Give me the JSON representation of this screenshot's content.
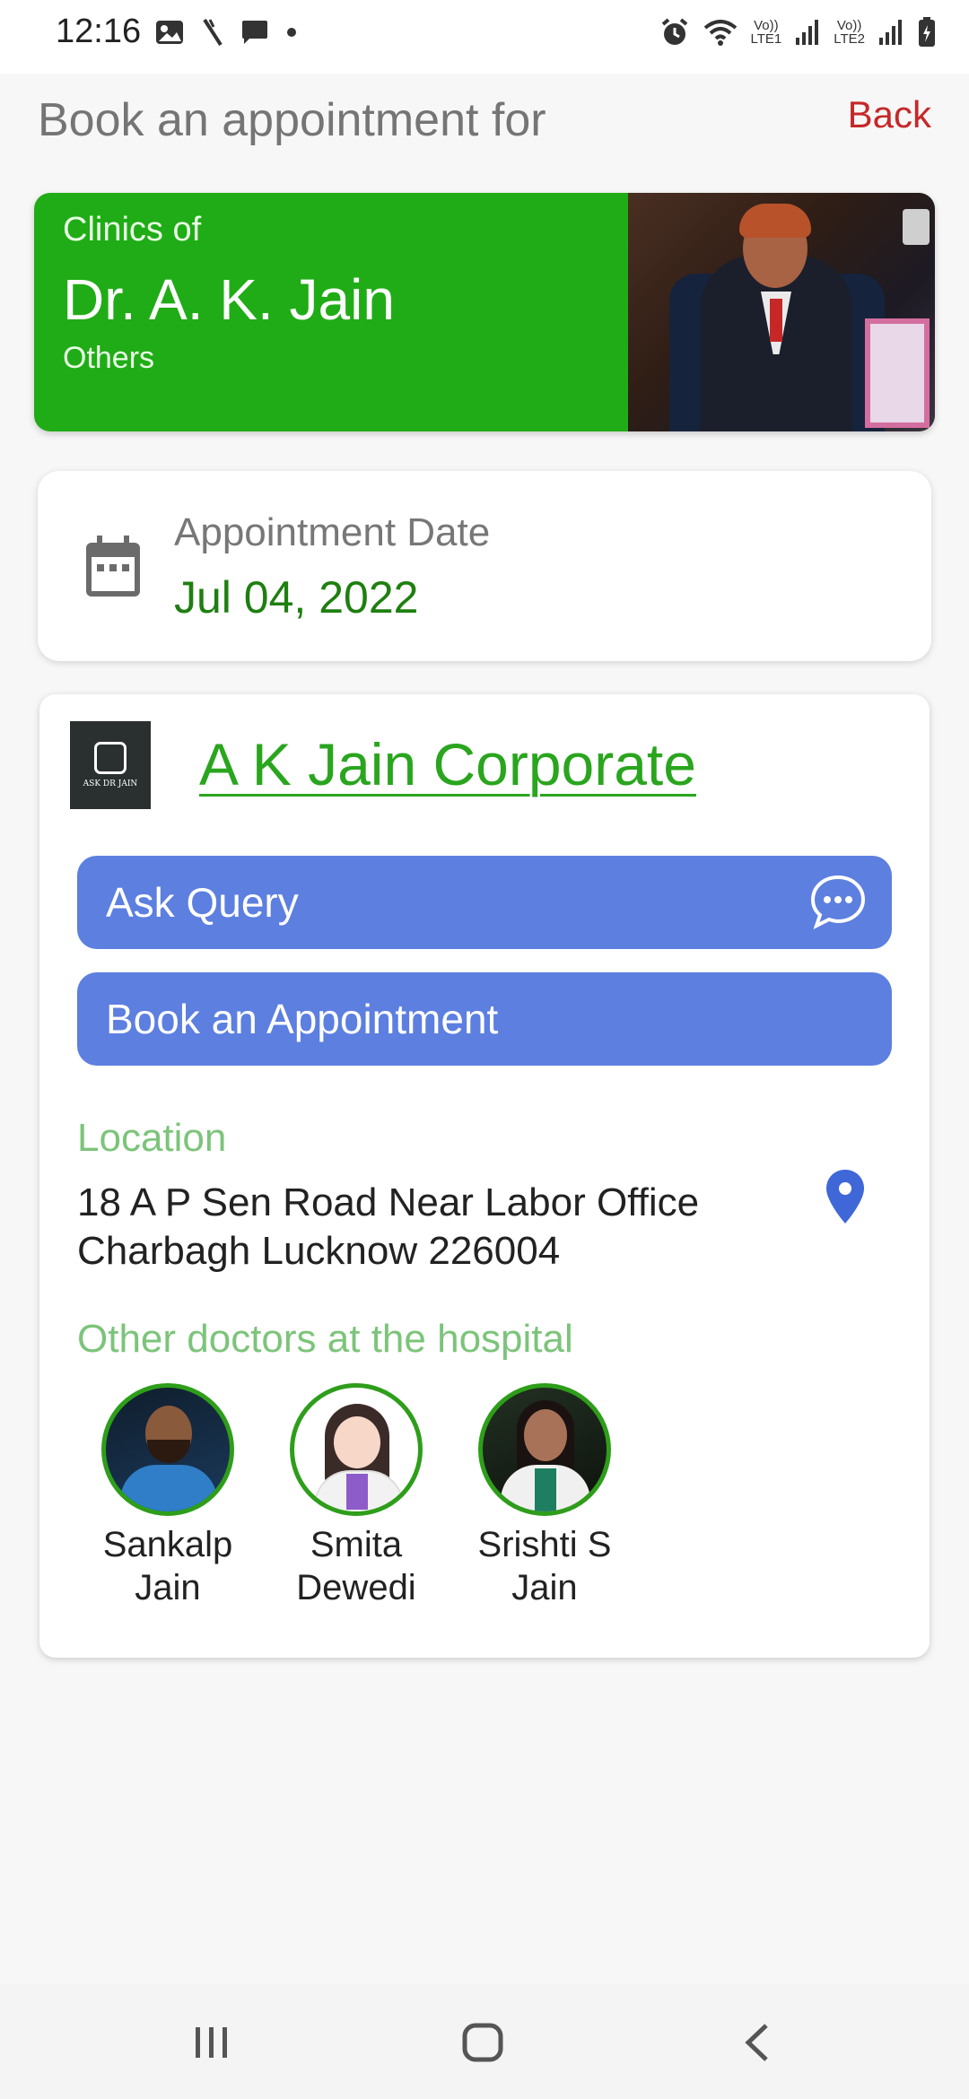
{
  "status_bar": {
    "time": "12:16",
    "sim1_label_top": "Vo))",
    "sim1_label_bottom": "LTE1",
    "sim2_label_top": "Vo))",
    "sim2_label_bottom": "LTE2",
    "left_icons": [
      "image-icon",
      "missed-call-icon",
      "chat-bubble-icon",
      "dot-icon"
    ],
    "right_icons": [
      "alarm-icon",
      "wifi-icon",
      "signal-icon",
      "battery-icon"
    ]
  },
  "header": {
    "title": "Book an appointment for",
    "back_label": "Back"
  },
  "doctor_card": {
    "clinics_of": "Clinics of",
    "doctor_name": "Dr. A. K. Jain",
    "speciality": "Others",
    "background_color": "#20ac16"
  },
  "appointment": {
    "label": "Appointment Date",
    "date": "Jul 04, 2022"
  },
  "clinic": {
    "logo_text": "ASK DR JAIN",
    "name": "A K Jain Corporate",
    "ask_query_label": "Ask Query",
    "book_label": "Book an Appointment",
    "button_color": "#5c7fe0",
    "location_label": "Location",
    "address_line1": "18 A P Sen Road Near Labor Office",
    "address_line2": "Charbagh Lucknow 226004",
    "other_doctors_label": "Other doctors at the hospital",
    "other_doctors": [
      {
        "first": "Sankalp",
        "last": "Jain"
      },
      {
        "first": "Smita",
        "last": "Dewedi"
      },
      {
        "first": "Srishti S",
        "last": "Jain"
      }
    ]
  },
  "nav_bar": {
    "icons": [
      "recent-apps-icon",
      "home-icon",
      "back-icon"
    ]
  },
  "colors": {
    "accent_green": "#2aa51e",
    "label_green": "#7cc47a",
    "back_red": "#c62828"
  }
}
